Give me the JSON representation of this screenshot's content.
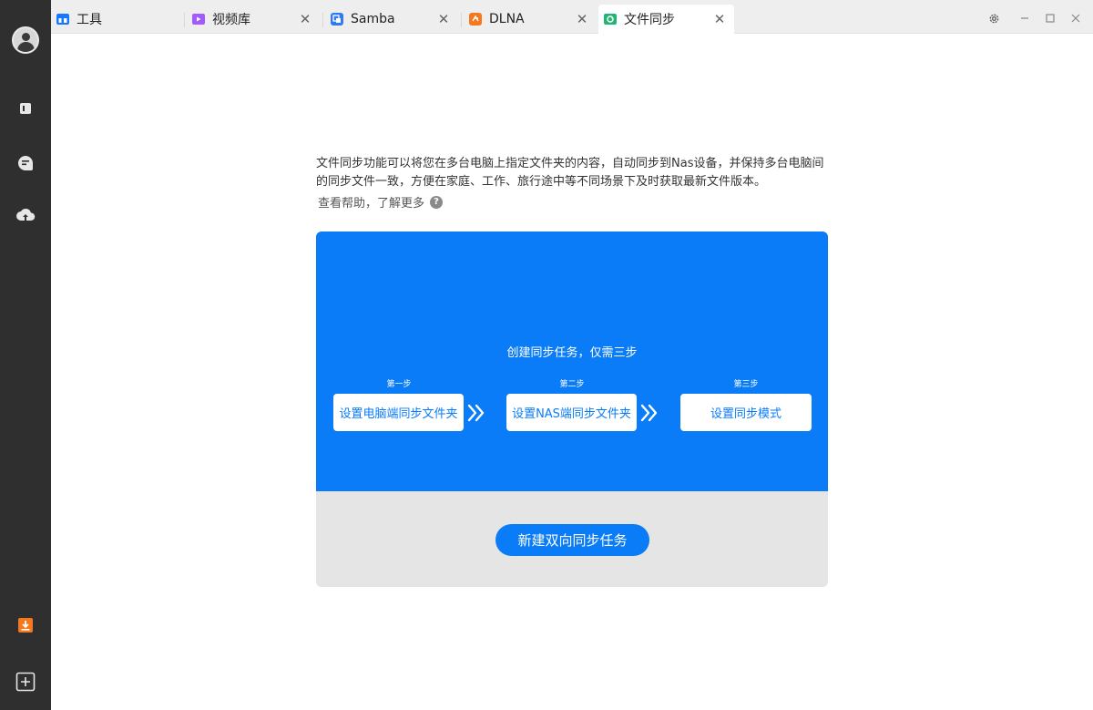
{
  "tabs": [
    {
      "label": "工具",
      "icon": "tool-store-icon",
      "color": "#1677ff",
      "active": false
    },
    {
      "label": "视频库",
      "icon": "video-library-icon",
      "color": "#a259ff",
      "active": false
    },
    {
      "label": "Samba",
      "icon": "samba-icon",
      "color": "#2f7bf5",
      "active": false
    },
    {
      "label": "DLNA",
      "icon": "dlna-icon",
      "color": "#f5781e",
      "active": false
    },
    {
      "label": "文件同步",
      "icon": "file-sync-icon",
      "color": "#22b573",
      "active": true
    }
  ],
  "window_controls": {
    "settings": "⚙",
    "minimize": "—",
    "maximize": "☐",
    "close": "✕"
  },
  "sidebar": {
    "items": [
      {
        "icon": "avatar-icon"
      },
      {
        "icon": "device-icon"
      },
      {
        "icon": "message-icon"
      },
      {
        "icon": "cloud-upload-icon"
      },
      {
        "icon": "download-icon",
        "color": "#f5781e"
      },
      {
        "icon": "add-icon"
      }
    ]
  },
  "intro": {
    "description_line1": "文件同步功能可以将您在多台电脑上指定文件夹的内容，自动同步到Nas设备，并保持多台电脑间",
    "description_line2": "的同步文件一致，方便在家庭、工作、旅行途中等不同场景下及时获取最新文件版本。",
    "help_link": "查看帮助，了解更多",
    "help_icon_text": "?"
  },
  "card": {
    "title": "创建同步任务，仅需三步",
    "steps": [
      {
        "label": "第一步",
        "action": "设置电脑端同步文件夹"
      },
      {
        "label": "第二步",
        "action": "设置NAS端同步文件夹"
      },
      {
        "label": "第三步",
        "action": "设置同步模式"
      }
    ],
    "primary_button": "新建双向同步任务",
    "accent_color": "#0a7cf8"
  }
}
